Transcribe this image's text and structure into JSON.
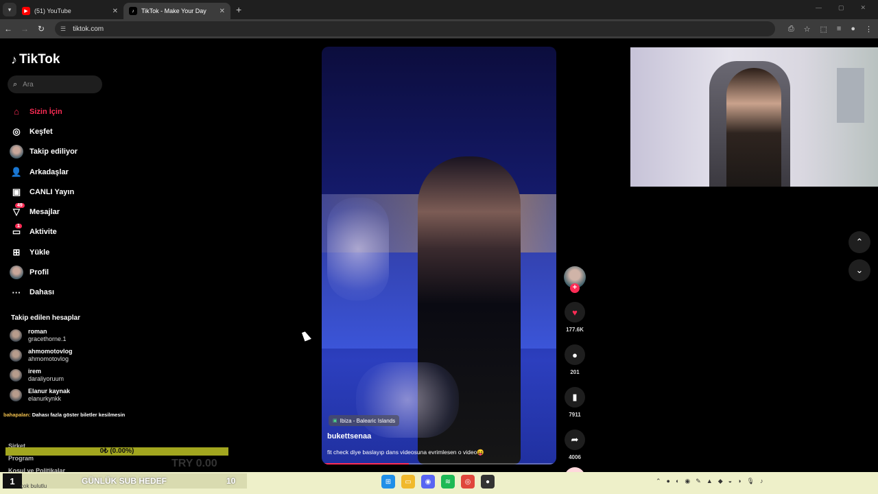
{
  "browser": {
    "tabs": [
      {
        "label": "(51) YouTube",
        "active": false,
        "icon": "youtube-icon"
      },
      {
        "label": "TikTok - Make Your Day",
        "active": true,
        "icon": "tiktok-icon"
      }
    ],
    "url": "tiktok.com"
  },
  "sidebar": {
    "logo": "TikTok",
    "search_placeholder": "Ara",
    "menu": [
      {
        "label": "Sizin İçin",
        "icon": "home-icon",
        "active": true
      },
      {
        "label": "Keşfet",
        "icon": "compass-icon"
      },
      {
        "label": "Takip ediliyor",
        "icon": "avatar"
      },
      {
        "label": "Arkadaşlar",
        "icon": "friends-icon"
      },
      {
        "label": "CANLI Yayın",
        "icon": "live-icon"
      },
      {
        "label": "Mesajlar",
        "icon": "messages-icon",
        "badge": "49"
      },
      {
        "label": "Aktivite",
        "icon": "activity-icon",
        "badge": "1"
      },
      {
        "label": "Yükle",
        "icon": "upload-icon"
      },
      {
        "label": "Profil",
        "icon": "avatar"
      },
      {
        "label": "Dahası",
        "icon": "more-icon"
      }
    ],
    "following_title": "Takip edilen hesaplar",
    "following": [
      {
        "name": "roman",
        "handle": "gracethorne.1"
      },
      {
        "name": "ahmomotovlog",
        "handle": "ahmomotovlog"
      },
      {
        "name": "irem",
        "handle": "daraliyoruum"
      },
      {
        "name": "Elanur kaynak",
        "handle": "elanurkynkk"
      }
    ],
    "footer": [
      "Şirket",
      "Program",
      "Koşul ve Politikalar"
    ]
  },
  "overlay": {
    "chat_user": "bahapalan:",
    "chat_message": "Dahası fazla göster biletler kesilmesin",
    "goal_text": "0₺ (0.00%)",
    "ghost_text": "TRY 0.00",
    "goal_widget": {
      "level": "1",
      "label": "GÜNLÜK SUB HEDEF",
      "count": "10"
    },
    "under_text": "çok bulutlu"
  },
  "video": {
    "location": "Ibiza - Balearic Islands",
    "username": "bukettsenaa",
    "caption": "fit check diye baslayıp dans videosuna evrimlesen o video😝",
    "progress": 0.37,
    "likes": "177.6K",
    "comments": "201",
    "bookmarks": "7911",
    "shares": "4006"
  },
  "colors": {
    "accent": "#fe2c55",
    "goal_bar": "#a2a61f",
    "taskbar": "#eef0c9"
  }
}
